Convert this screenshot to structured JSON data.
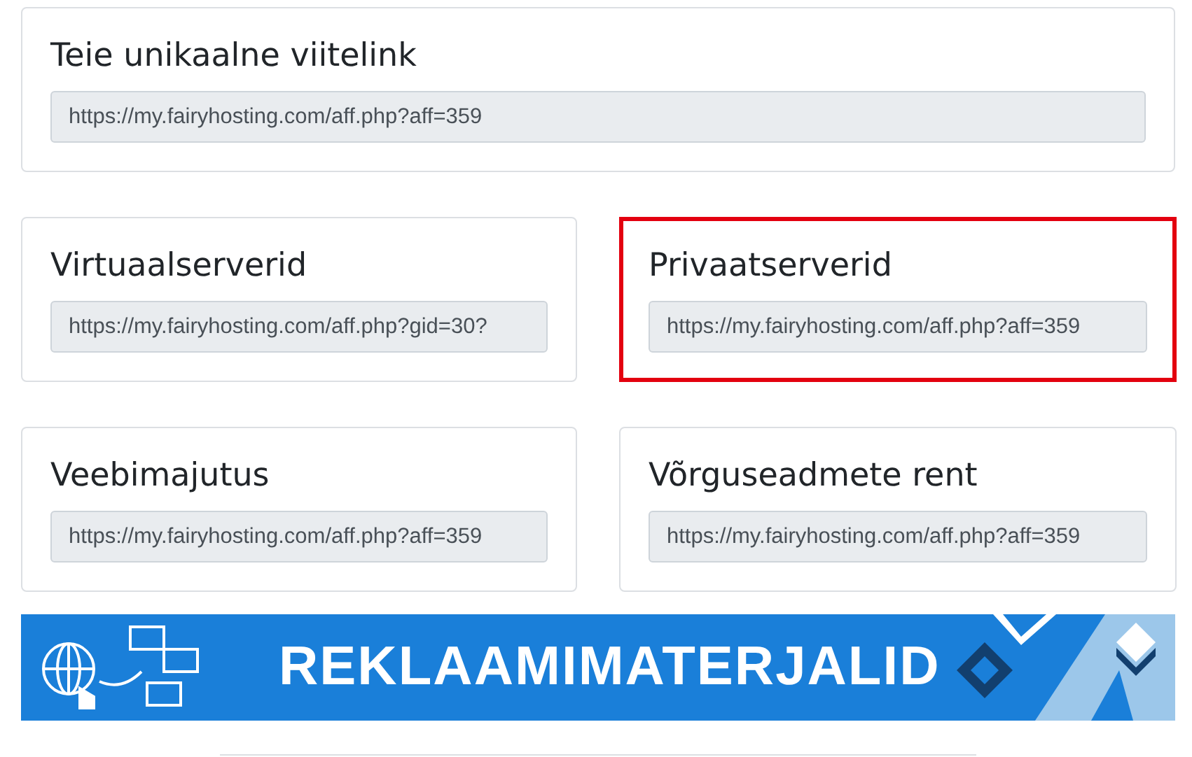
{
  "main_link": {
    "title": "Teie unikaalne viitelink",
    "value": "https://my.fairyhosting.com/aff.php?aff=359"
  },
  "links": [
    {
      "title": "Virtuaalserverid",
      "value": "https://my.fairyhosting.com/aff.php?gid=30?",
      "highlighted": false
    },
    {
      "title": "Privaatserverid",
      "value": "https://my.fairyhosting.com/aff.php?aff=359",
      "highlighted": true
    },
    {
      "title": "Veebimajutus",
      "value": "https://my.fairyhosting.com/aff.php?aff=359",
      "highlighted": false
    },
    {
      "title": "Võrguseadmete rent",
      "value": "https://my.fairyhosting.com/aff.php?aff=359",
      "highlighted": false
    }
  ],
  "banner": {
    "title": "REKLAAMIMATERJALID"
  }
}
